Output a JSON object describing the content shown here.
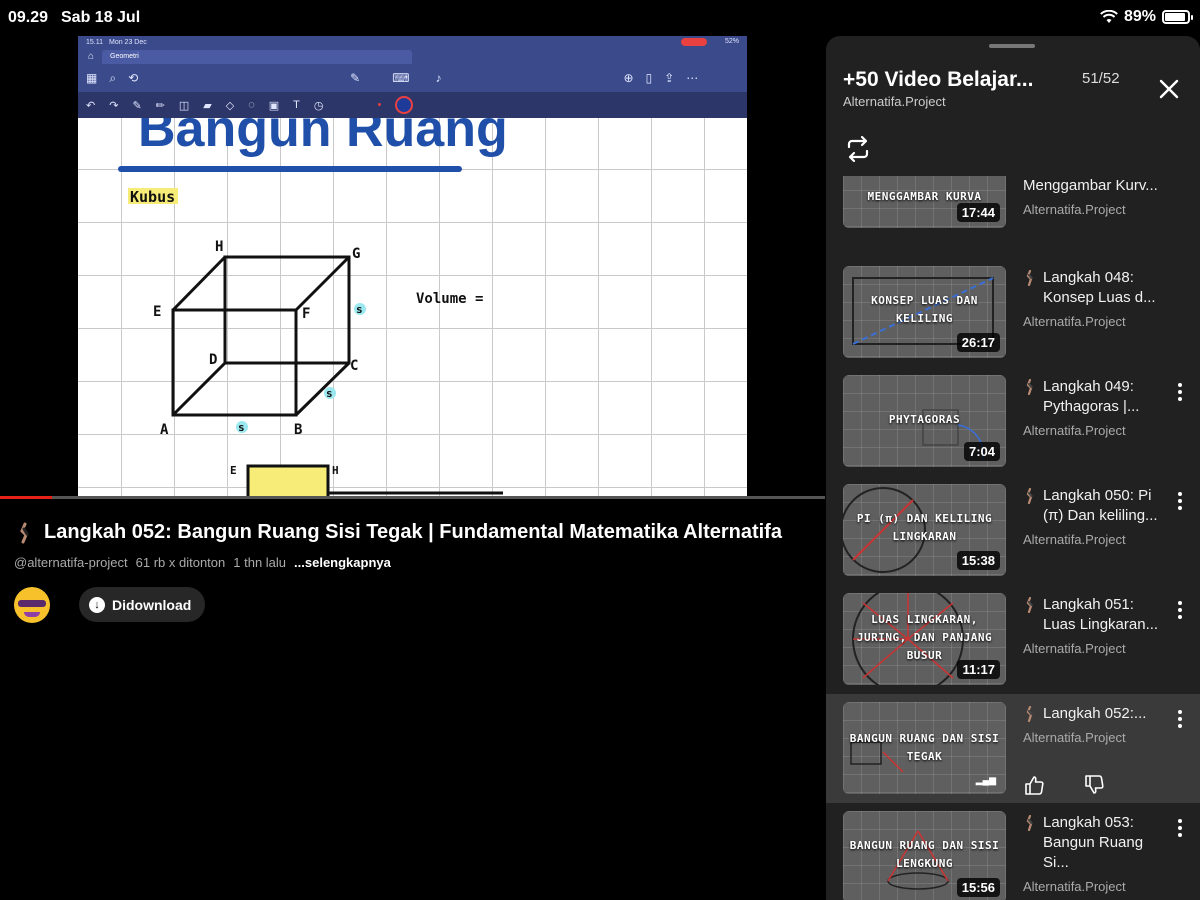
{
  "status_bar": {
    "time": "09.29",
    "date": "Sab 18 Jul",
    "battery": "89%",
    "battery_level": 0.89
  },
  "video": {
    "status_time": "15.11",
    "status_date": "Mon 23 Dec",
    "status_batt": "52%",
    "tab_label": "Geometri",
    "heading": "Bangun Ruang",
    "subheading": "Kubus",
    "volume_label": "Volume =",
    "vertices": {
      "H": "H",
      "G": "G",
      "E": "E",
      "F": "F",
      "D": "D",
      "C": "C",
      "A": "A",
      "B": "B"
    },
    "side_label": "s",
    "progress_fraction": 0.063
  },
  "title": "Langkah 052: Bangun Ruang Sisi Tegak | Fundamental Matematika Alternatifa",
  "meta": {
    "handle": "@alternatifa-project",
    "views": "61 rb x ditonton",
    "age": "1 thn lalu",
    "more": "...selengkapnya"
  },
  "download_button": "Didownload",
  "playlist": {
    "title": "+50 Video Belajar...",
    "count": "51/52",
    "channel": "Alternatifa.Project",
    "items": [
      {
        "caption": "MENGGAMBAR KURVA",
        "duration": "17:44",
        "title": "Menggambar Kurv...",
        "channel": "Alternatifa.Project"
      },
      {
        "caption": "KONSEP LUAS DAN KELILING",
        "duration": "26:17",
        "title": "Langkah 048: Konsep Luas d...",
        "channel": "Alternatifa.Project"
      },
      {
        "caption": "PHYTAGORAS",
        "duration": "7:04",
        "title": "Langkah 049: Pythagoras |...",
        "channel": "Alternatifa.Project"
      },
      {
        "caption": "PI (π) DAN KELILING LINGKARAN",
        "duration": "15:38",
        "title": "Langkah 050: Pi (π) Dan keliling...",
        "channel": "Alternatifa.Project"
      },
      {
        "caption": "LUAS LINGKARAN, JURING, DAN PANJANG BUSUR",
        "duration": "11:17",
        "title": "Langkah 051: Luas Lingkaran...",
        "channel": "Alternatifa.Project"
      },
      {
        "caption": "BANGUN RUANG DAN SISI TEGAK",
        "duration": "",
        "title": "Langkah 052:...",
        "channel": "Alternatifa.Project"
      },
      {
        "caption": "BANGUN RUANG DAN SISI LENGKUNG",
        "duration": "15:56",
        "title": "Langkah 053: Bangun Ruang Si...",
        "channel": "Alternatifa.Project"
      }
    ]
  },
  "colors": {
    "accent_red": "#e62117",
    "panel_bg": "#212121",
    "active_row_bg": "#3a3a3a",
    "heading_blue": "#1f4fa8"
  }
}
